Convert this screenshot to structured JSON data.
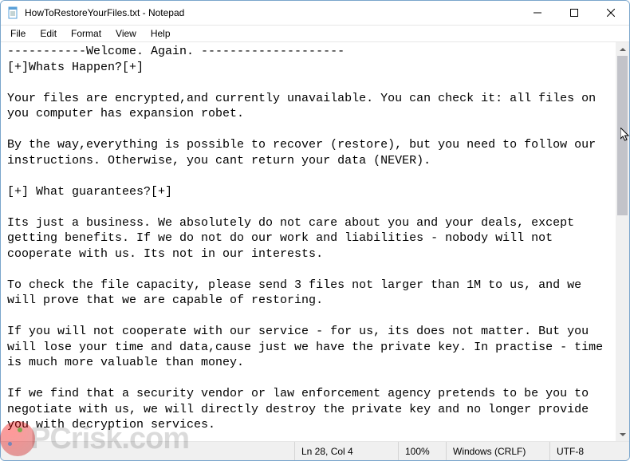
{
  "window": {
    "title": "HowToRestoreYourFiles.txt - Notepad"
  },
  "menu": {
    "file": "File",
    "edit": "Edit",
    "format": "Format",
    "view": "View",
    "help": "Help"
  },
  "document": {
    "text": "-----------Welcome. Again. --------------------\n[+]Whats Happen?[+]\n\nYour files are encrypted,and currently unavailable. You can check it: all files on you computer has expansion robet.\n\nBy the way,everything is possible to recover (restore), but you need to follow our instructions. Otherwise, you cant return your data (NEVER).\n\n[+] What guarantees?[+]\n\nIts just a business. We absolutely do not care about you and your deals, except getting benefits. If we do not do our work and liabilities - nobody will not cooperate with us. Its not in our interests.\n\nTo check the file capacity, please send 3 files not larger than 1M to us, and we will prove that we are capable of restoring.\n\nIf you will not cooperate with our service - for us, its does not matter. But you will lose your time and data,cause just we have the private key. In practise - time is much more valuable than money.\n\nIf we find that a security vendor or law enforcement agency pretends to be you to negotiate with us, we will directly destroy the private key and no longer provide you with decryption services."
  },
  "status": {
    "position": "Ln 28, Col 4",
    "zoom": "100%",
    "eol": "Windows (CRLF)",
    "encoding": "UTF-8"
  },
  "watermark": {
    "text": "PCrisk.com"
  }
}
